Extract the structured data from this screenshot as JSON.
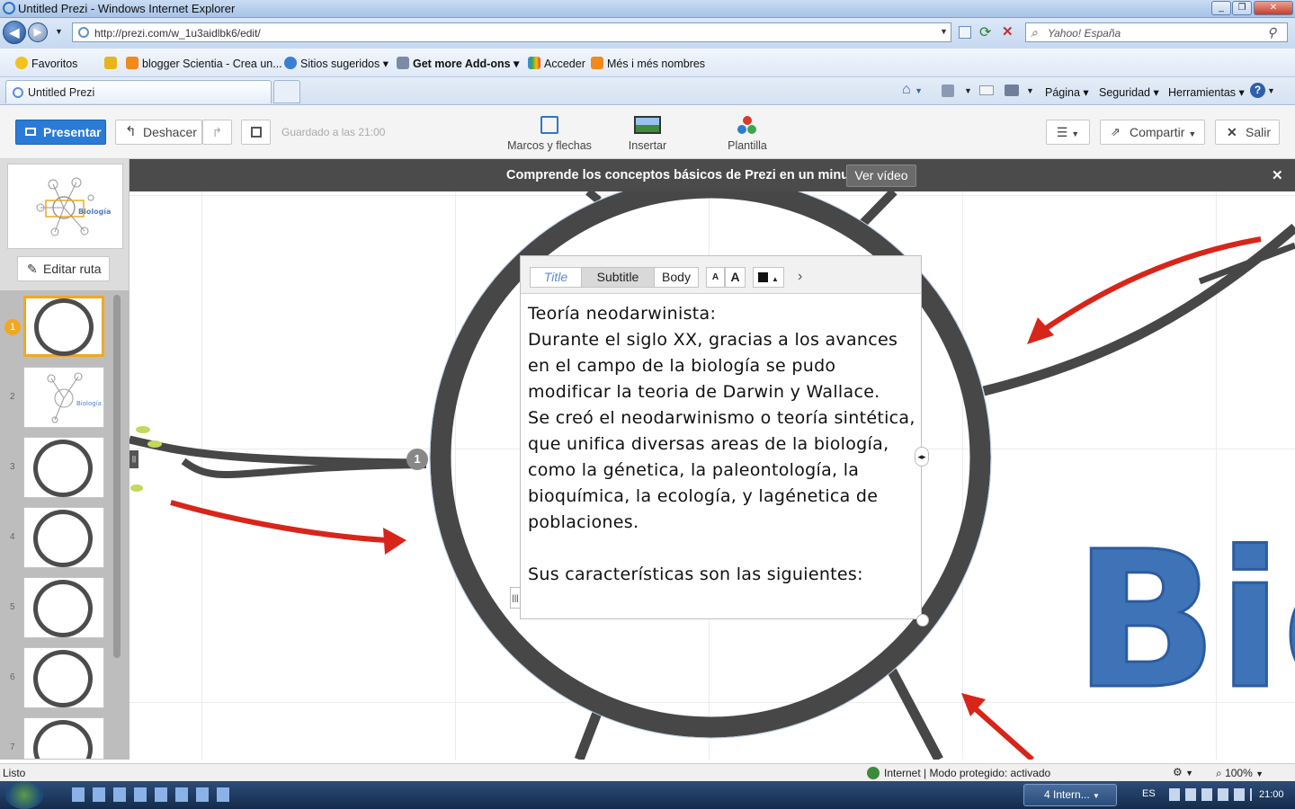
{
  "window": {
    "title": "Untitled Prezi - Windows Internet Explorer"
  },
  "browser": {
    "url": "http://prezi.com/w_1u3aidlbk6/edit/",
    "search_placeholder": "Yahoo! España",
    "favorites": [
      {
        "label": "Favoritos",
        "icon": "star-icon"
      },
      {
        "label": "blogger Scientia - Crea un...",
        "icon": "blogger-icon"
      },
      {
        "label": "Sitios sugeridos",
        "icon": "ie-icon"
      },
      {
        "label": "Get more Add-ons",
        "icon": "addons-icon"
      },
      {
        "label": "Acceder",
        "icon": "google-icon"
      },
      {
        "label": "Més i més nombres",
        "icon": "blogger-icon"
      }
    ],
    "tab_title": "Untitled Prezi",
    "commands": [
      "Página",
      "Seguridad",
      "Herramientas"
    ]
  },
  "prezi_toolbar": {
    "present": "Presentar",
    "undo": "Deshacer",
    "saved": "Guardado a las 21:00",
    "tools": [
      "Marcos y flechas",
      "Insertar",
      "Plantilla"
    ],
    "share": "Compartir",
    "exit": "Salir"
  },
  "banner": {
    "message": "Comprende los conceptos básicos de Prezi en un minuto.",
    "button": "Ver vídeo"
  },
  "sidebar": {
    "edit_route": "Editar ruta",
    "slides": [
      "1",
      "2",
      "3",
      "4",
      "5",
      "6",
      "7"
    ],
    "selected_slide": "1"
  },
  "editor": {
    "styles": [
      "Title",
      "Subtitle",
      "Body"
    ],
    "text": [
      "Teoría neodarwinista:",
      "Durante el siglo XX, gracias a los avances en el campo de la biología se pudo modificar la teoria de Darwin y Wallace.",
      "Se creó el neodarwinismo o teoría sintética, que unifica diversas areas de la biología, como la génetica, la paleontología, la bioquímica, la ecología, y lagénetica de poblaciones.",
      "",
      "Sus características son las siguientes:"
    ]
  },
  "canvas": {
    "path_marker": "1",
    "big_word": "Bio",
    "thumb_word": "Biología"
  },
  "status": {
    "left": "Listo",
    "zone": "Internet | Modo protegido: activado",
    "zoom": "100%"
  },
  "taskbar": {
    "task": "4 Intern...",
    "lang": "ES",
    "clock": "21:00"
  },
  "colors": {
    "present_blue": "#2a7bd6",
    "arrow_red": "#d8251a",
    "circle_dark": "#474747",
    "bio_blue": "#3f73b8",
    "slide_selected": "#f0a823"
  }
}
